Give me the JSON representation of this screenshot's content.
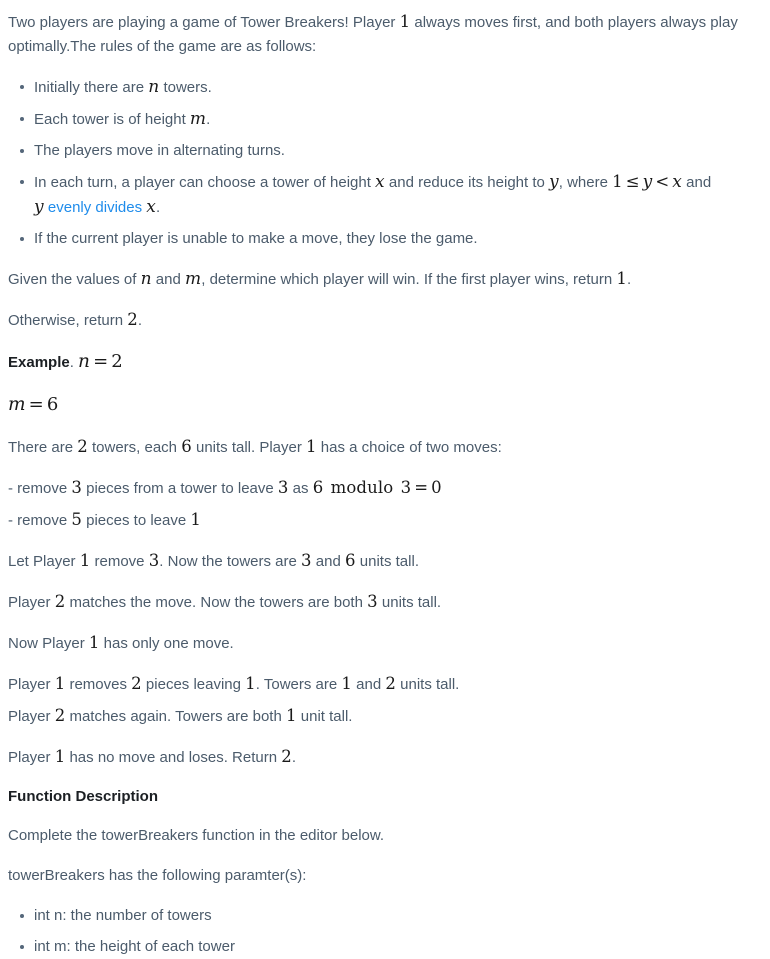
{
  "document": {
    "type": "problem-statement",
    "colors": {
      "body_text": "#4b5b6b",
      "heading_text": "#1b1f23",
      "math_text": "#1a1a1a",
      "link": "#1f8ceb",
      "background": "#ffffff",
      "bullet": "#55677a"
    }
  },
  "intro": {
    "p1_a": "Two players are playing a game of Tower Breakers! Player ",
    "p1_math_1": "1",
    "p1_b": " always moves first, and both players always play optimally.The rules of the game are as follows:"
  },
  "rules": {
    "items": [
      {
        "a": "Initially there are ",
        "math_1": "n",
        "b": " towers."
      },
      {
        "a": "Each tower is of height ",
        "math_1": "m",
        "b": "."
      },
      {
        "a": "The players move in alternating turns.",
        "math_1": "",
        "b": ""
      },
      {
        "a": "In each turn, a player can choose a tower of height ",
        "math_1": "x",
        "b": " and reduce its height to ",
        "math_2": "y",
        "c": ", where ",
        "math_3": "1 ≤ y < x",
        "d": " and ",
        "math_4": "y",
        "link": "evenly divides",
        "math_5": "x",
        "e": "."
      },
      {
        "a": "If the current player is unable to make a move, they lose the game.",
        "math_1": "",
        "b": ""
      }
    ]
  },
  "determine": {
    "p_a": "Given the values of ",
    "math_n": "n",
    "p_b": " and ",
    "math_m": "m",
    "p_c": ", determine which player will win. If the first player wins, return ",
    "math_1": "1",
    "p_d": ".",
    "p2_a": "Otherwise, return ",
    "math_2": "2",
    "p2_b": "."
  },
  "example": {
    "label": "Example",
    "label_suffix": ".",
    "n_expr": "n = 2",
    "m_expr": "m = 6",
    "lines": [
      {
        "a": "There are ",
        "m1": "2",
        "b": " towers, each ",
        "m2": "6",
        "c": " units tall. Player ",
        "m3": "1",
        "d": " has a choice of two moves:"
      }
    ],
    "moves": [
      {
        "a": "- remove ",
        "m1": "3",
        "b": " pieces from a tower to leave ",
        "m2": "3",
        "c": " as ",
        "m3": "6 modulo 3 = 0",
        "d": ""
      },
      {
        "a": "- remove ",
        "m1": "5",
        "b": " pieces to leave ",
        "m2": "1",
        "c": "",
        "m3": "",
        "d": ""
      }
    ],
    "walkthrough": [
      {
        "a": "Let Player ",
        "m1": "1",
        "b": " remove ",
        "m2": "3",
        "c": ". Now the towers are ",
        "m3": "3",
        "d": " and ",
        "m4": "6",
        "e": " units tall."
      },
      {
        "a": "Player ",
        "m1": "2",
        "b": " matches the move. Now the towers are both ",
        "m2": "3",
        "c": " units tall.",
        "m3": "",
        "d": "",
        "m4": "",
        "e": ""
      },
      {
        "a": "Now Player ",
        "m1": "1",
        "b": " has only one move.",
        "m2": "",
        "c": "",
        "m3": "",
        "d": "",
        "m4": "",
        "e": ""
      },
      {
        "a": "Player ",
        "m1": "1",
        "b": " removes ",
        "m2": "2",
        "c": " pieces leaving ",
        "m3": "1",
        "d": ". Towers are ",
        "m4": "1",
        "e": " and ",
        "m5": "2",
        "f": " units tall."
      },
      {
        "a": "Player ",
        "m1": "2",
        "b": " matches again. Towers are both ",
        "m2": "1",
        "c": " unit tall.",
        "m3": "",
        "d": "",
        "m4": "",
        "e": ""
      },
      {
        "a": "Player ",
        "m1": "1",
        "b": " has no move and loses. Return ",
        "m2": "2",
        "c": ".",
        "m3": "",
        "d": "",
        "m4": "",
        "e": ""
      }
    ]
  },
  "function_description": {
    "heading": "Function Description",
    "complete_line": "Complete the towerBreakers function in the editor below.",
    "params_intro": "towerBreakers has the following paramter(s):",
    "params": [
      "int n: the number of towers",
      "int m: the height of each tower"
    ]
  }
}
